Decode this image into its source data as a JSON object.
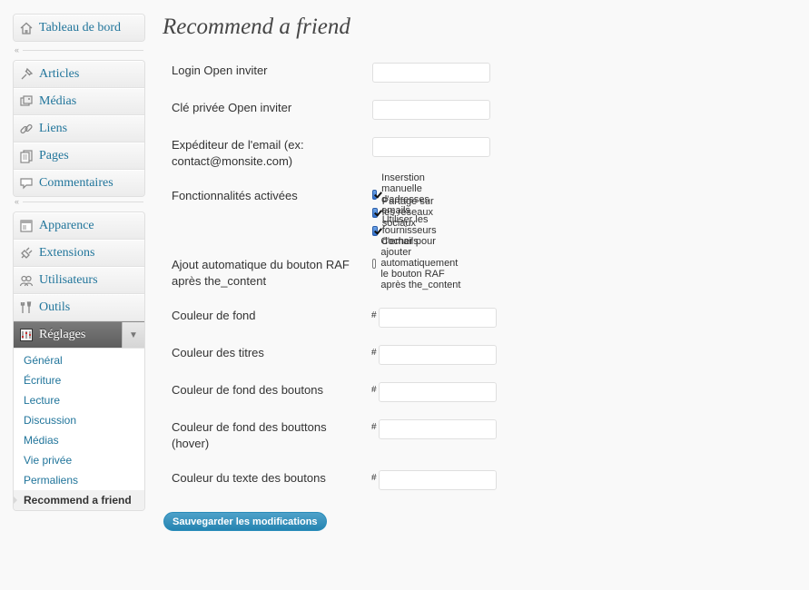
{
  "sidebar": {
    "dashboard": "Tableau de bord",
    "separator_arrows": "«",
    "group1": [
      "Articles",
      "Médias",
      "Liens",
      "Pages",
      "Commentaires"
    ],
    "group2": [
      "Apparence",
      "Extensions",
      "Utilisateurs",
      "Outils"
    ],
    "settings": "Réglages",
    "settings_sub": [
      "Général",
      "Écriture",
      "Lecture",
      "Discussion",
      "Médias",
      "Vie privée",
      "Permaliens",
      "Recommend a friend"
    ],
    "current_sub": "Recommend a friend"
  },
  "main": {
    "title": "Recommend a friend",
    "fields": {
      "login_label": "Login Open inviter",
      "login_value": "",
      "key_label": "Clé privée Open inviter",
      "key_value": "",
      "sender_label": "Expéditeur de l'email (ex: contact@monsite.com)",
      "sender_value": "",
      "features_label": "Fonctionnalités activées",
      "feature_1": "Inserstion manuelle d'adresses emails",
      "feature_2": "Partage sur les réseaux sociaux",
      "feature_3": "Utiliser les fournisseurs d'emails",
      "auto_label": "Ajout automatique du bouton RAF après the_content",
      "auto_option": "Cocher pour ajouter automatiquement le bouton RAF après the_content",
      "hash": "#",
      "bg_label": "Couleur de fond",
      "titles_label": "Couleur des titres",
      "btn_bg_label": "Couleur de fond des boutons",
      "btn_hover_label": "Couleur de fond des bouttons (hover)",
      "btn_text_label": "Couleur du texte des boutons"
    },
    "checkboxes": {
      "feature_1": true,
      "feature_2": true,
      "feature_3": true,
      "auto": false
    },
    "save_label": "Sauvegarder les modifications"
  },
  "colors": {
    "link": "#21759b",
    "button": "#2584b1",
    "settings_header": "#6a6a6a"
  }
}
